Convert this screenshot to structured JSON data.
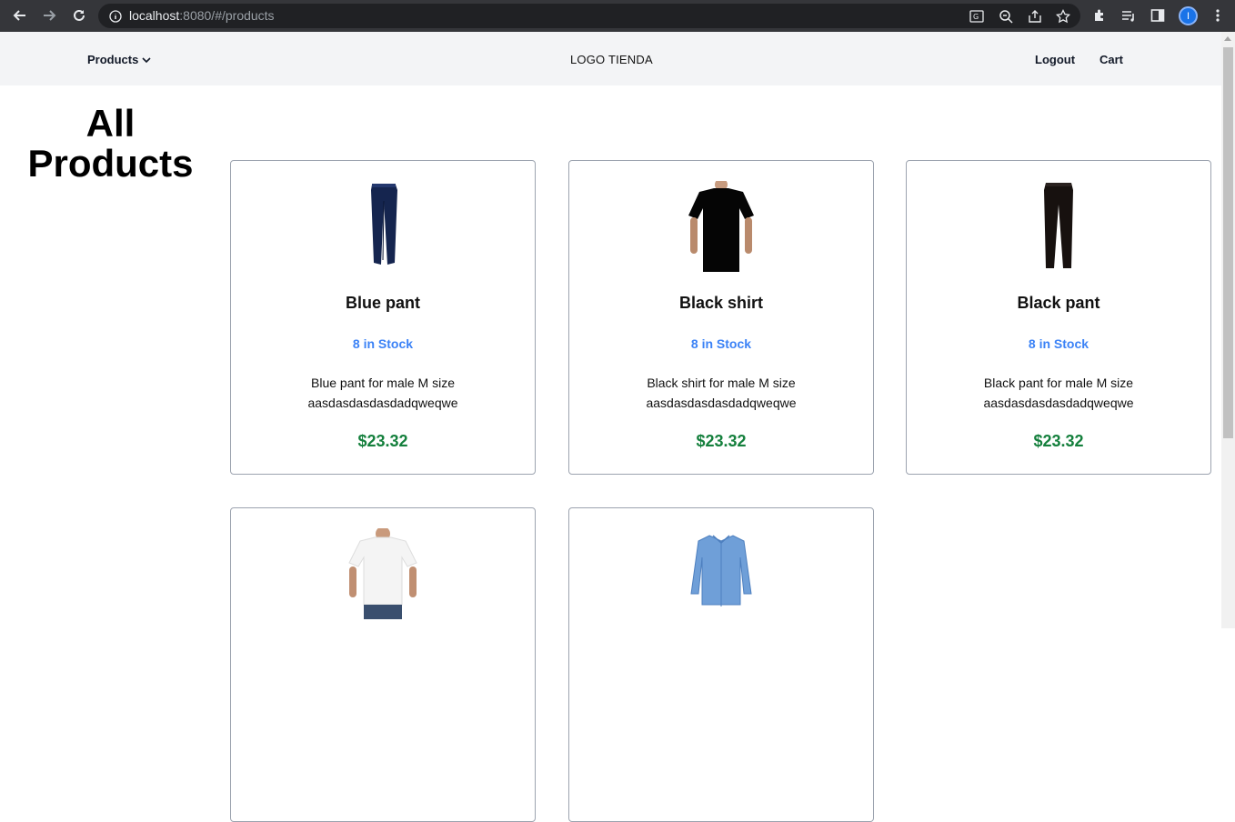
{
  "browser": {
    "url_host": "localhost",
    "url_rest": ":8080/#/products",
    "profile_initial": "I"
  },
  "header": {
    "products_label": "Products",
    "logo_text": "LOGO TIENDA",
    "logout_label": "Logout",
    "cart_label": "Cart"
  },
  "page": {
    "title": "All Products"
  },
  "products": [
    {
      "name": "Blue pant",
      "stock": "8 in Stock",
      "description": "Blue pant for male M size aasdasdasdasdadqweqwe",
      "price": "$23.32",
      "image": "blue-pant"
    },
    {
      "name": "Black shirt",
      "stock": "8 in Stock",
      "description": "Black shirt for male M size aasdasdasdasdadqweqwe",
      "price": "$23.32",
      "image": "black-shirt"
    },
    {
      "name": "Black pant",
      "stock": "8 in Stock",
      "description": "Black pant for male M size aasdasdasdasdadqweqwe",
      "price": "$23.32",
      "image": "black-pant"
    },
    {
      "image": "white-tshirt"
    },
    {
      "image": "blue-dress-shirt"
    }
  ],
  "colors": {
    "stock": "#3b82f6",
    "price": "#15803d",
    "header_bg": "#f3f4f6"
  }
}
